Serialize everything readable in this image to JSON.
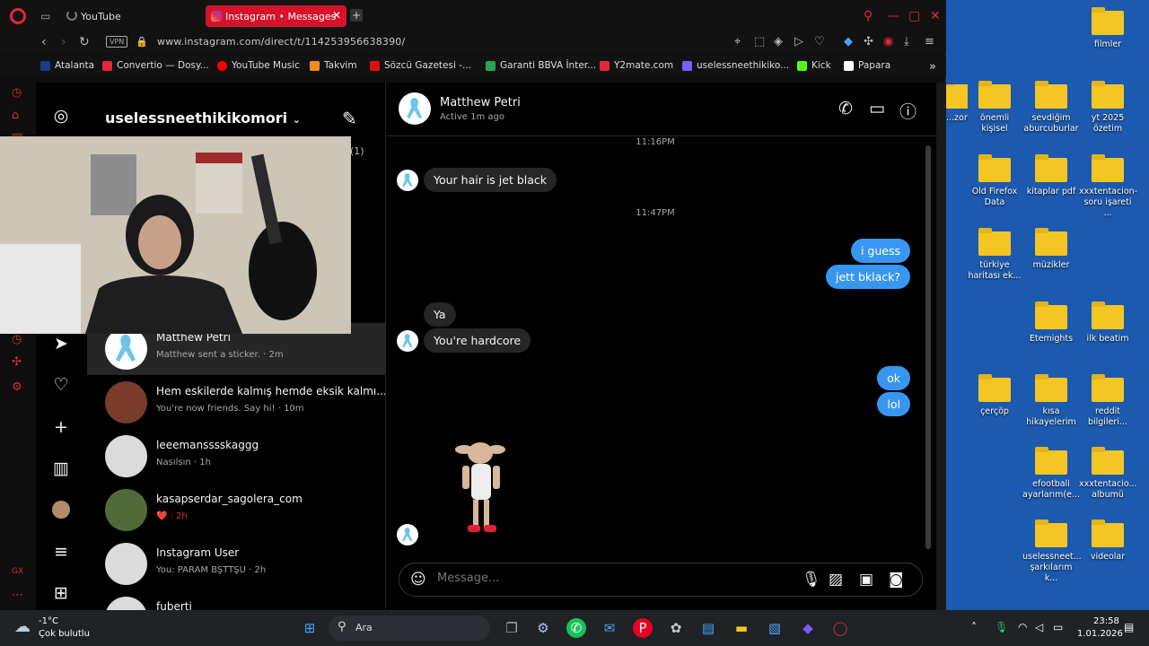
{
  "browser": {
    "tabs": [
      {
        "label": "YouTube",
        "active": false
      },
      {
        "label": "Instagram • Messages",
        "active": true
      }
    ],
    "url": "www.instagram.com/direct/t/114253956638390/",
    "vpn_label": "VPN",
    "bookmarks": [
      {
        "label": "Atalanta",
        "color": "#1e3a8a"
      },
      {
        "label": "Convertio — Dosy...",
        "color": "#e0283a"
      },
      {
        "label": "YouTube Music",
        "color": "#ff0000"
      },
      {
        "label": "Takvim",
        "color": "#f28c28"
      },
      {
        "label": "Sözcü Gazetesi -...",
        "color": "#d11"
      },
      {
        "label": "Garanti BBVA İnter...",
        "color": "#2ea44f"
      },
      {
        "label": "Y2mate.com",
        "color": "#e0283a"
      },
      {
        "label": "uselessneethikiko...",
        "color": "#7b5cff"
      },
      {
        "label": "Kick",
        "color": "#53fc18"
      },
      {
        "label": "Papara",
        "color": "#ffffff"
      }
    ]
  },
  "instagram": {
    "username": "uselessneethikikomori",
    "requests_count": "(1)",
    "conversations": [
      {
        "name": "Matthew Petri",
        "sub": "Matthew sent a sticker. · 2m",
        "active": true
      },
      {
        "name": "Hem eskilerde kalmış hemde eksik kalmı...",
        "sub": "You're now friends. Say hi! · 10m",
        "active": false
      },
      {
        "name": "leeemansssskaggg",
        "sub": "Nasılsın · 1h",
        "active": false
      },
      {
        "name": "kasapserdar_sagolera_com",
        "sub": "❤️ · 2h",
        "active": false
      },
      {
        "name": "Instagram User",
        "sub": "You: PARAM BŞTTŞU · 2h",
        "active": false
      },
      {
        "name": "fuberti",
        "sub": "",
        "active": false
      }
    ]
  },
  "chat": {
    "contact_name": "Matthew Petri",
    "contact_status": "Active 1m ago",
    "messages": [
      {
        "type": "time",
        "text": "11:16PM"
      },
      {
        "type": "in",
        "text": "Your hair is jet black"
      },
      {
        "type": "time",
        "text": "11:47PM"
      },
      {
        "type": "out",
        "text": "i guess"
      },
      {
        "type": "out",
        "text": "jett  bklack?"
      },
      {
        "type": "in",
        "text": "Ya"
      },
      {
        "type": "in",
        "text": "You're hardcore"
      },
      {
        "type": "out",
        "text": "ok"
      },
      {
        "type": "out",
        "text": "lol"
      }
    ],
    "input_placeholder": "Message..."
  },
  "desktop": {
    "icons": [
      {
        "label": "filmler"
      },
      {
        "label": "...zon ...ülü..."
      },
      {
        "label": "önemli kişisel"
      },
      {
        "label": "sevdiğim aburcuburlar"
      },
      {
        "label": "yt 2025 özetim"
      },
      {
        "label": "Old Firefox Data"
      },
      {
        "label": "kitaplar pdf"
      },
      {
        "label": "xxxtentacion-soru işareti ..."
      },
      {
        "label": "türkiye haritası ek..."
      },
      {
        "label": "müzikler"
      },
      {
        "label": "Etemights"
      },
      {
        "label": "ilk beatim"
      },
      {
        "label": "çerçöp"
      },
      {
        "label": "kısa hikayelerim"
      },
      {
        "label": "reddit bilgileri..."
      },
      {
        "label": "efootball ayarlarım(e..."
      },
      {
        "label": "xxxtentacio... albumü"
      },
      {
        "label": "uselessneet... şarkılarım k..."
      },
      {
        "label": "videolar"
      }
    ]
  },
  "taskbar": {
    "weather_temp": "-1°C",
    "weather_desc": "Çok bulutlu",
    "search_label": "Ara",
    "time": "23:58",
    "date": "1.01.2026"
  }
}
